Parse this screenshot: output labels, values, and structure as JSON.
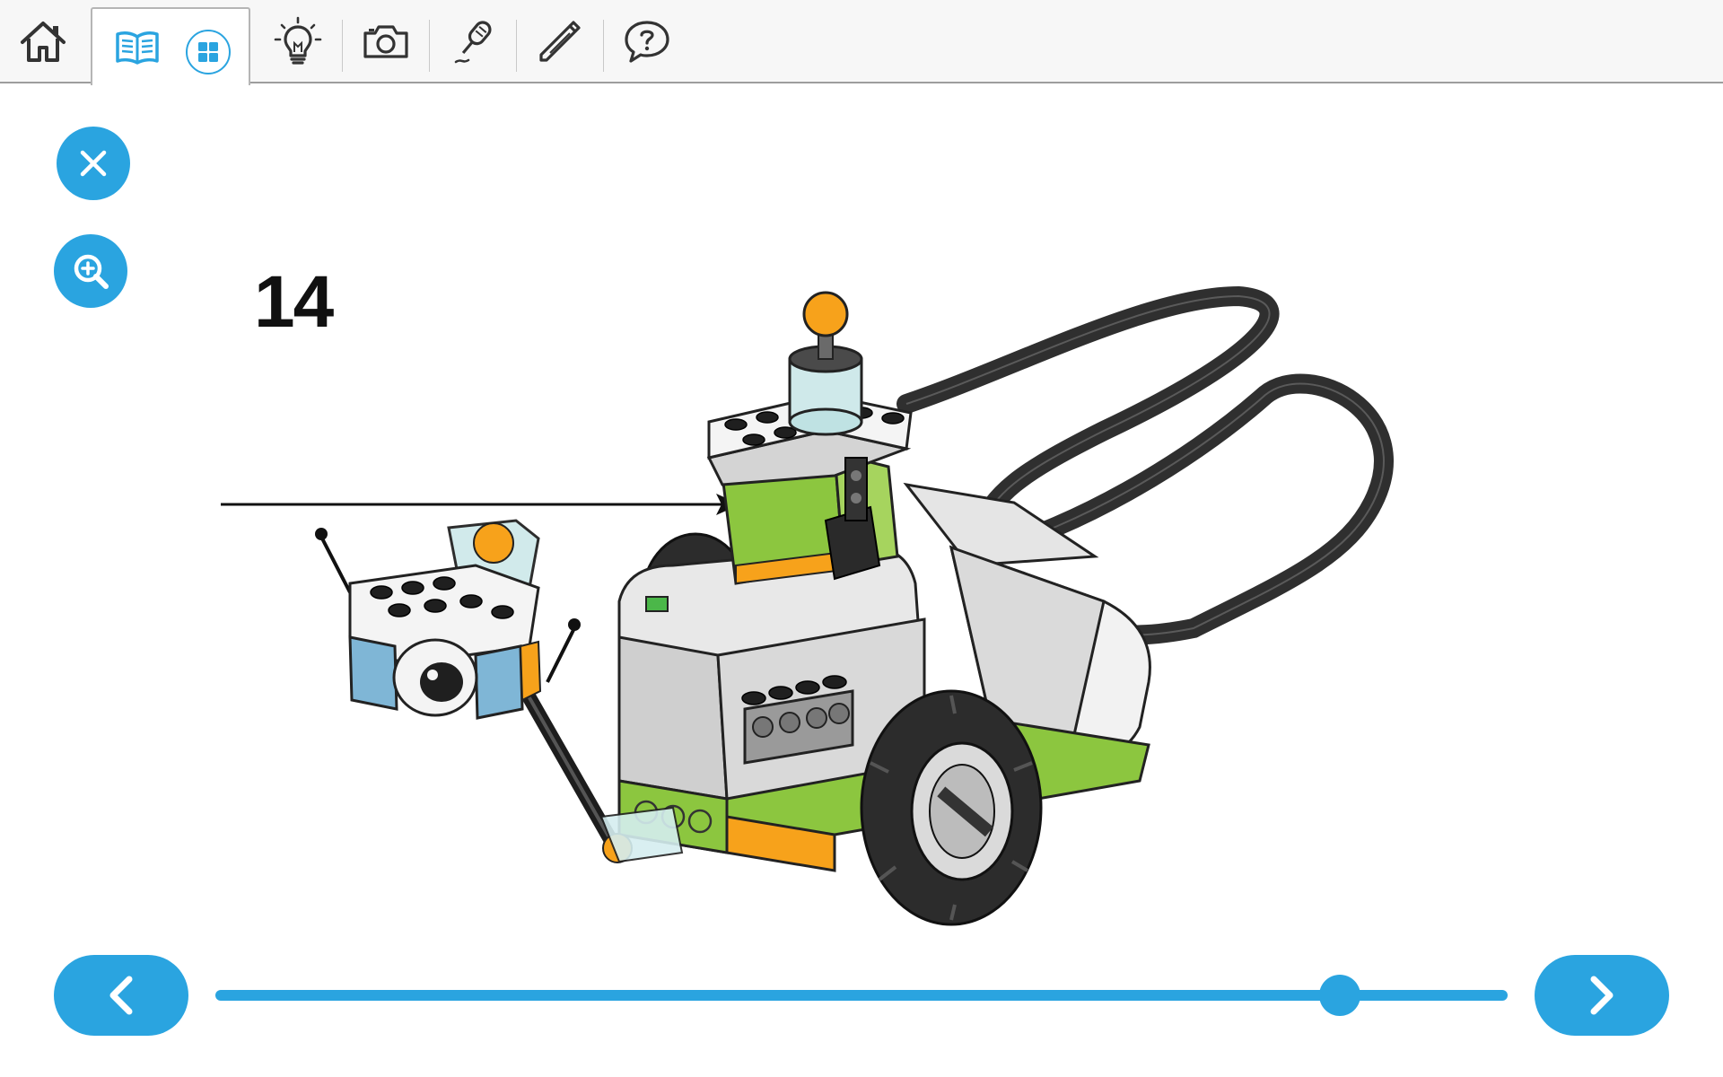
{
  "toolbar": {
    "items": [
      {
        "name": "home-button",
        "icon": "home-icon"
      },
      {
        "name": "instructions-tab",
        "icon": "book-icon"
      },
      {
        "name": "building-grid-button",
        "icon": "grid-icon"
      },
      {
        "name": "idea-button",
        "icon": "lightbulb-icon"
      },
      {
        "name": "camera-button",
        "icon": "camera-icon"
      },
      {
        "name": "microphone-button",
        "icon": "microphone-icon"
      },
      {
        "name": "pencil-button",
        "icon": "pencil-icon"
      },
      {
        "name": "help-button",
        "icon": "help-bubble-icon"
      }
    ]
  },
  "side_buttons": {
    "close": {
      "icon": "close-icon"
    },
    "zoom": {
      "icon": "zoom-in-icon"
    }
  },
  "step": {
    "number": "14"
  },
  "navigation": {
    "prev": {
      "icon": "chevron-left-icon"
    },
    "next": {
      "icon": "chevron-right-icon"
    },
    "progress": 0.87
  },
  "colors": {
    "accent": "#2aa4e0",
    "lime": "#8cc63f",
    "orange": "#f7a21b",
    "brick_gray": "#cfcfcf",
    "dark_gray": "#3a3a3a",
    "cable": "#333333"
  }
}
